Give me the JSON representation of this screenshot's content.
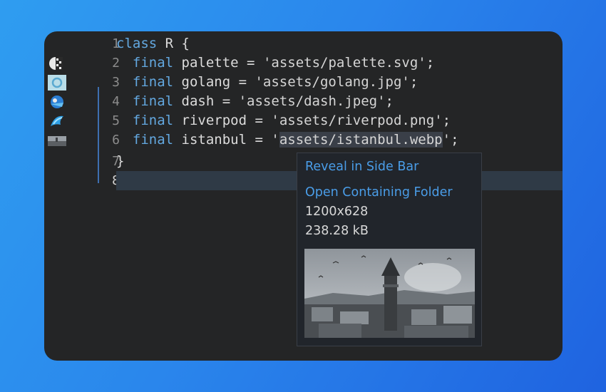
{
  "editor": {
    "line_numbers": [
      "1",
      "2",
      "3",
      "4",
      "5",
      "6",
      "7",
      "8"
    ],
    "code": [
      {
        "kw": "class",
        "rest": " R {"
      },
      {
        "indent": "  ",
        "kw": "final",
        "name": " palette = ",
        "str": "'assets/palette.svg'",
        "end": ";"
      },
      {
        "indent": "  ",
        "kw": "final",
        "name": " golang = ",
        "str": "'assets/golang.jpg'",
        "end": ";"
      },
      {
        "indent": "  ",
        "kw": "final",
        "name": " dash = ",
        "str": "'assets/dash.jpeg'",
        "end": ";"
      },
      {
        "indent": "  ",
        "kw": "final",
        "name": " riverpod = ",
        "str": "'assets/riverpod.png'",
        "end": ";"
      },
      {
        "indent": "  ",
        "kw": "final",
        "name": " istanbul = ",
        "str_pre": "'",
        "str_hl": "assets/istanbul.webp",
        "str_post": "'",
        "end": ";"
      },
      {
        "rest": "}"
      },
      {
        "rest": ""
      }
    ],
    "current_line": 8,
    "gutter_icons": [
      "palette-icon",
      "golang-icon",
      "dash-icon",
      "riverpod-icon",
      "istanbul-thumbnail-icon"
    ]
  },
  "hover": {
    "reveal_label": "Reveal in Side Bar",
    "open_folder_label": "Open Containing Folder",
    "dimensions": "1200x628",
    "file_size": "238.28 kB",
    "preview_name": "istanbul-preview-image"
  },
  "colors": {
    "background": "#2a86ec",
    "editor_bg": "#242526",
    "keyword": "#63a8e0",
    "link": "#4a9de8"
  }
}
